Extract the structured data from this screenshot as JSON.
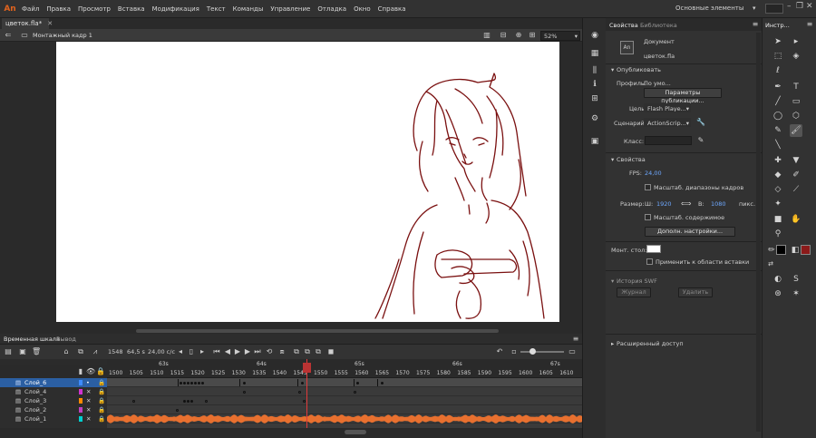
{
  "app": {
    "logo": "An",
    "menu": [
      "Файл",
      "Правка",
      "Просмотр",
      "Вставка",
      "Модификация",
      "Текст",
      "Команды",
      "Управление",
      "Отладка",
      "Окно",
      "Справка"
    ],
    "workspace": "Основные элементы",
    "window_controls": [
      "–",
      "❐",
      "✕"
    ]
  },
  "document": {
    "tab": "цветок.fla*",
    "scene": "Монтажный кадр 1",
    "zoom": "52%"
  },
  "timeline": {
    "tabs": [
      "Временная шкала",
      "Вывод"
    ],
    "frame": "1548",
    "time": "64,5 s",
    "fps": "24,00 c/c",
    "seconds": [
      "63s",
      "64s",
      "65s",
      "66s",
      "67s"
    ],
    "frame_numbers": [
      "1500",
      "1505",
      "1510",
      "1515",
      "1520",
      "1525",
      "1530",
      "1535",
      "1540",
      "1545",
      "1550",
      "1555",
      "1560",
      "1565",
      "1570",
      "1575",
      "1580",
      "1585",
      "1590",
      "1595",
      "1600",
      "1605",
      "1610"
    ],
    "layers": [
      {
        "name": "Слой_6",
        "color": "#3d8bff"
      },
      {
        "name": "Слой_4",
        "color": "#d033d0"
      },
      {
        "name": "Слой_3",
        "color": "#ff8a00"
      },
      {
        "name": "Слой_2",
        "color": "#c040c0"
      },
      {
        "name": "Слой_1",
        "color": "#00d0d0"
      }
    ]
  },
  "panel": {
    "tabs": [
      "Свойства",
      "Библиотека"
    ],
    "doc_type": "Документ",
    "doc_name": "цветок.fla",
    "doc_icon": "An",
    "publish": {
      "title": "Опубликовать",
      "profile_label": "Профиль:",
      "profile_value": "По умо...",
      "publish_settings_button": "Параметры публикации...",
      "target_label": "Цель:",
      "target_value": "Flash Playe...",
      "script_label": "Сценарий:",
      "script_value": "ActionScrip...",
      "class_label": "Класс:"
    },
    "properties": {
      "title": "Свойства",
      "fps_label": "FPS:",
      "fps_value": "24,00",
      "scale_spans_label": "Масштаб. диапазоны кадров",
      "size_label": "Размер:",
      "w_label": "Ш:",
      "width": "1920",
      "h_label": "В:",
      "height": "1080",
      "unit": "пикс.",
      "scale_content_label": "Масштаб. содержимое",
      "advanced_button": "Дополн. настройки..."
    },
    "stage_label": "Монт. стол:",
    "stage_color": "#ffffff",
    "apply_paste_label": "Применить к области вставки",
    "swf_history": {
      "title": "История SWF",
      "log_button": "Журнал",
      "clear_button": "Удалить"
    },
    "advanced_access": "Расширенный доступ"
  },
  "tools_panel": {
    "title": "Инстр...",
    "stroke_color": "#000000",
    "fill_color": "#8b1a1a"
  }
}
